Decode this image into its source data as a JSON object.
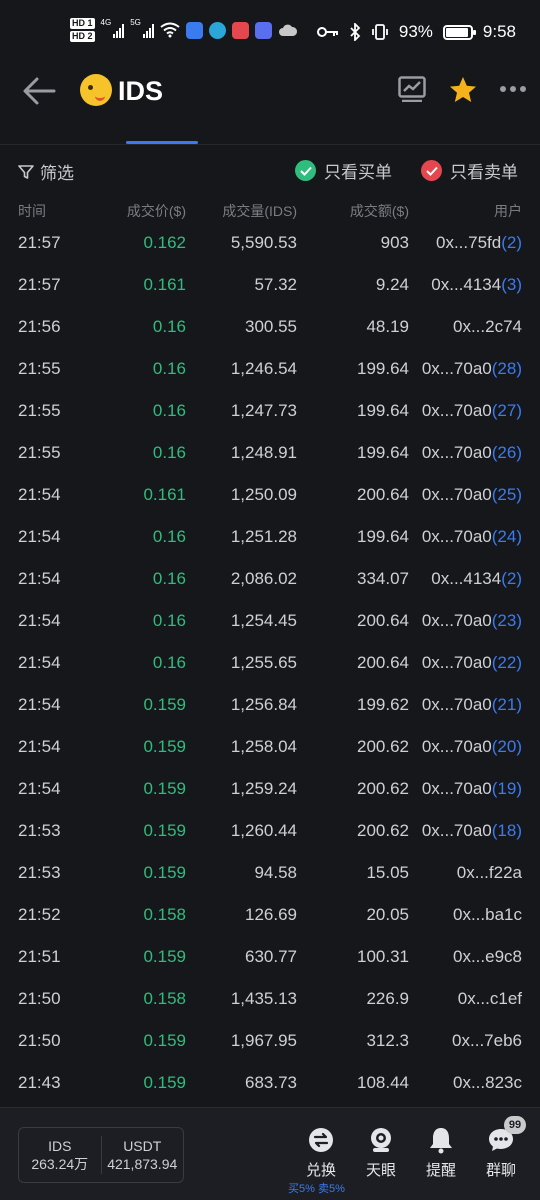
{
  "status_bar": {
    "hd1": "HD 1",
    "hd2": "HD 2",
    "net1": "4G",
    "net2": "5G",
    "battery": "93%",
    "time": "9:58"
  },
  "header": {
    "coin_name": "IDS"
  },
  "filters": {
    "filter_label": "筛选",
    "buy_only_label": "只看买单",
    "sell_only_label": "只看卖单",
    "buy_color": "#2fbd7d",
    "sell_color": "#e5474f"
  },
  "table": {
    "headers": [
      "时间",
      "成交价($)",
      "成交量(IDS)",
      "成交额($)",
      "用户"
    ],
    "rows": [
      {
        "time": "21:57",
        "price": "0.162",
        "volume": "5,590.53",
        "amount": "903",
        "user": "0x...75fd",
        "count": "(2)"
      },
      {
        "time": "21:57",
        "price": "0.161",
        "volume": "57.32",
        "amount": "9.24",
        "user": "0x...4134",
        "count": "(3)"
      },
      {
        "time": "21:56",
        "price": "0.16",
        "volume": "300.55",
        "amount": "48.19",
        "user": "0x...2c74",
        "count": ""
      },
      {
        "time": "21:55",
        "price": "0.16",
        "volume": "1,246.54",
        "amount": "199.64",
        "user": "0x...70a0",
        "count": "(28)"
      },
      {
        "time": "21:55",
        "price": "0.16",
        "volume": "1,247.73",
        "amount": "199.64",
        "user": "0x...70a0",
        "count": "(27)"
      },
      {
        "time": "21:55",
        "price": "0.16",
        "volume": "1,248.91",
        "amount": "199.64",
        "user": "0x...70a0",
        "count": "(26)"
      },
      {
        "time": "21:54",
        "price": "0.161",
        "volume": "1,250.09",
        "amount": "200.64",
        "user": "0x...70a0",
        "count": "(25)"
      },
      {
        "time": "21:54",
        "price": "0.16",
        "volume": "1,251.28",
        "amount": "199.64",
        "user": "0x...70a0",
        "count": "(24)"
      },
      {
        "time": "21:54",
        "price": "0.16",
        "volume": "2,086.02",
        "amount": "334.07",
        "user": "0x...4134",
        "count": "(2)"
      },
      {
        "time": "21:54",
        "price": "0.16",
        "volume": "1,254.45",
        "amount": "200.64",
        "user": "0x...70a0",
        "count": "(23)"
      },
      {
        "time": "21:54",
        "price": "0.16",
        "volume": "1,255.65",
        "amount": "200.64",
        "user": "0x...70a0",
        "count": "(22)"
      },
      {
        "time": "21:54",
        "price": "0.159",
        "volume": "1,256.84",
        "amount": "199.62",
        "user": "0x...70a0",
        "count": "(21)"
      },
      {
        "time": "21:54",
        "price": "0.159",
        "volume": "1,258.04",
        "amount": "200.62",
        "user": "0x...70a0",
        "count": "(20)"
      },
      {
        "time": "21:54",
        "price": "0.159",
        "volume": "1,259.24",
        "amount": "200.62",
        "user": "0x...70a0",
        "count": "(19)"
      },
      {
        "time": "21:53",
        "price": "0.159",
        "volume": "1,260.44",
        "amount": "200.62",
        "user": "0x...70a0",
        "count": "(18)"
      },
      {
        "time": "21:53",
        "price": "0.159",
        "volume": "94.58",
        "amount": "15.05",
        "user": "0x...f22a",
        "count": ""
      },
      {
        "time": "21:52",
        "price": "0.158",
        "volume": "126.69",
        "amount": "20.05",
        "user": "0x...ba1c",
        "count": ""
      },
      {
        "time": "21:51",
        "price": "0.159",
        "volume": "630.77",
        "amount": "100.31",
        "user": "0x...e9c8",
        "count": ""
      },
      {
        "time": "21:50",
        "price": "0.158",
        "volume": "1,435.13",
        "amount": "226.9",
        "user": "0x...c1ef",
        "count": ""
      },
      {
        "time": "21:50",
        "price": "0.159",
        "volume": "1,967.95",
        "amount": "312.3",
        "user": "0x...7eb6",
        "count": ""
      },
      {
        "time": "21:43",
        "price": "0.159",
        "volume": "683.73",
        "amount": "108.44",
        "user": "0x...823c",
        "count": ""
      }
    ]
  },
  "bottom": {
    "ids_label": "IDS",
    "ids_balance": "263.24万",
    "usdt_label": "USDT",
    "usdt_balance": "421,873.94",
    "swap_label": "兑换",
    "fee_note": "买5% 卖5%",
    "eye_label": "天眼",
    "alert_label": "提醒",
    "chat_label": "群聊",
    "chat_badge": "99",
    "accent_color": "#3a7bf0"
  }
}
